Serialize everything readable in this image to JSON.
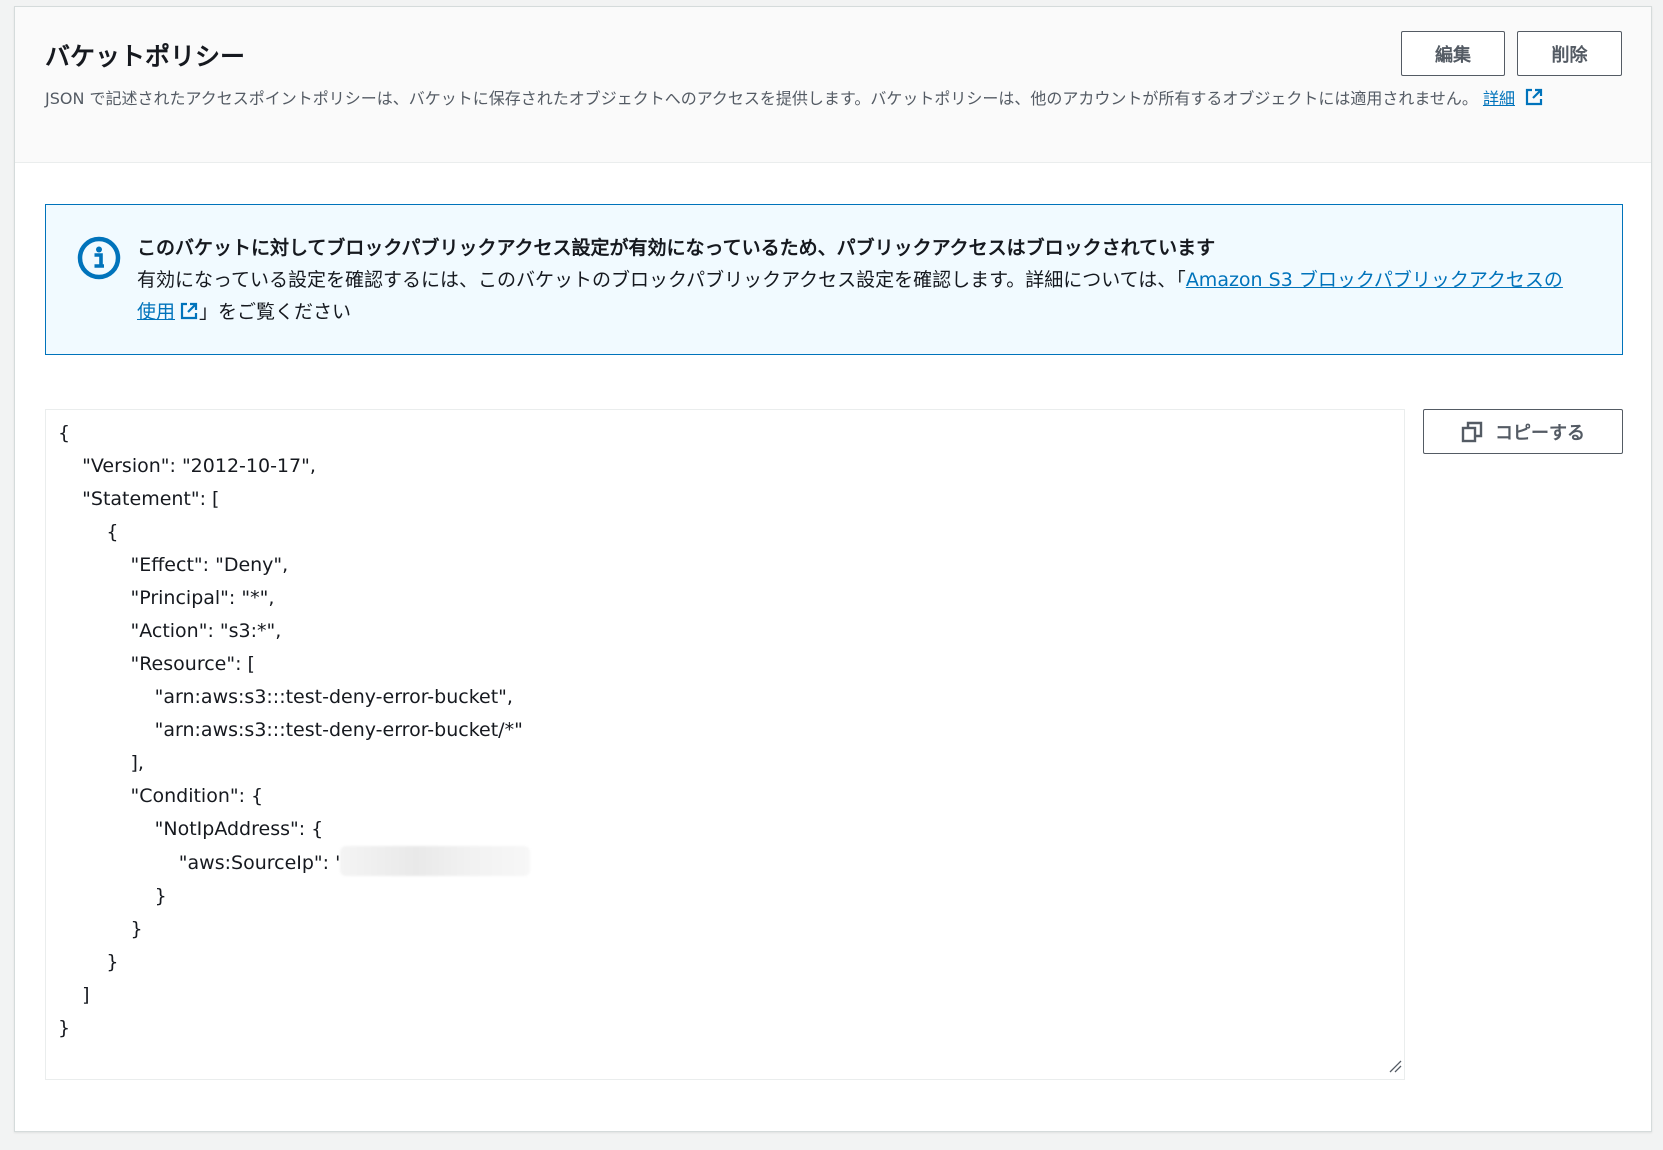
{
  "header": {
    "title": "バケットポリシー",
    "description": "JSON で記述されたアクセスポイントポリシーは、バケットに保存されたオブジェクトへのアクセスを提供します。バケットポリシーは、他のアカウントが所有するオブジェクトには適用されません。",
    "details_link": "詳細",
    "edit_label": "編集",
    "delete_label": "削除"
  },
  "alert": {
    "title": "このバケットに対してブロックパブリックアクセス設定が有効になっているため、パブリックアクセスはブロックされています",
    "body_prefix": "有効になっている設定を確認するには、このバケットのブロックパブリックアクセス設定を確認します。詳細については、「",
    "link_text": "Amazon S3 ブロックパブリックアクセスの使用",
    "body_suffix": "」をご覧ください"
  },
  "editor": {
    "copy_label": "コピーする",
    "lines": [
      "{",
      "    \"Version\": \"2012-10-17\",",
      "    \"Statement\": [",
      "        {",
      "            \"Effect\": \"Deny\",",
      "            \"Principal\": \"*\",",
      "            \"Action\": \"s3:*\",",
      "            \"Resource\": [",
      "                \"arn:aws:s3:::test-deny-error-bucket\",",
      "                \"arn:aws:s3:::test-deny-error-bucket/*\"",
      "            ],",
      "            \"Condition\": {",
      "                \"NotIpAddress\": {",
      "                    \"aws:SourceIp\": '",
      "                }",
      "            }",
      "        }",
      "    ]",
      "}"
    ]
  },
  "colors": {
    "link": "#0073bb",
    "alert_border": "#0073bb",
    "alert_bg": "#f1faff",
    "button_border": "#545b64"
  }
}
